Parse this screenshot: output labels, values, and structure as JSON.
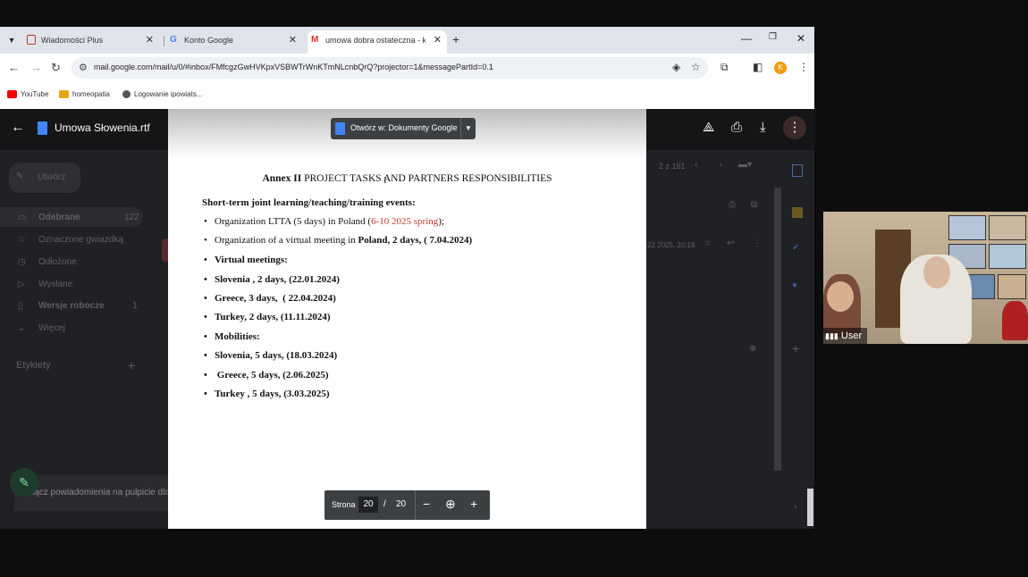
{
  "tabs": [
    {
      "title": "Wiadomości Plus",
      "active": false
    },
    {
      "title": "Konto Google",
      "active": false
    },
    {
      "title": "umowa dobra ostateczna - kar",
      "active": true
    }
  ],
  "address": {
    "url": "mail.google.com/mail/u/0/#inbox/FMfcgzGwHVKpxVSBWTrWnKTmNLcnbQrQ?projector=1&messagePartId=0.1"
  },
  "profile_initial": "K",
  "bookmarks": [
    "YouTube",
    "homeopatia",
    "Logowanie ipowiats..."
  ],
  "viewer": {
    "file_name": "Umowa Słowenia.rtf",
    "open_with_label": "Otwórz w: Dokumenty Google"
  },
  "gmail_sidebar": {
    "compose": "Utwórz",
    "items": [
      {
        "label": "Odebrane",
        "count": "122"
      },
      {
        "label": "Oznaczone gwiazdką",
        "count": ""
      },
      {
        "label": "Odłożone",
        "count": ""
      },
      {
        "label": "Wysłane",
        "count": ""
      },
      {
        "label": "Wersje robocze",
        "count": "1"
      },
      {
        "label": "Więcej",
        "count": ""
      }
    ],
    "labels_heading": "Etykiety",
    "toast": "łącz powiadomienia na pulpicie dla"
  },
  "gmail_bg": {
    "range": "2 z 161",
    "date": "22 2025, 20:18"
  },
  "document": {
    "heading_bold": "Annex II",
    "heading_rest": " PROJECT TASKS AND PARTNERS RESPONSIBILITIES",
    "subheading": "Short-term joint learning/teaching/training events:",
    "item1_prefix": "Organization LTTA (5 days) in Poland (",
    "item1_red": "6-10 2025 spring",
    "item1_suffix": ");",
    "item2_prefix": "Organization of a virtual meeting in ",
    "item2_bold": "Poland, 2 days, ( 7.04.2024)",
    "items_bold": [
      "Virtual meetings:",
      "Slovenia , 2 days, (22.01.2024)",
      "Greece, 3 days,  ( 22.04.2024)",
      "Turkey, 2 days, (11.11.2024)",
      "Mobilities:",
      "Slovenia, 5 days, (18.03.2024)",
      " Greece, 5 days, (2.06.2025)",
      "Turkey , 5 days, (3.03.2025)"
    ]
  },
  "pager": {
    "label": "Strona",
    "current": "20",
    "separator": "/",
    "total": "20"
  },
  "video": {
    "participant": "User"
  }
}
